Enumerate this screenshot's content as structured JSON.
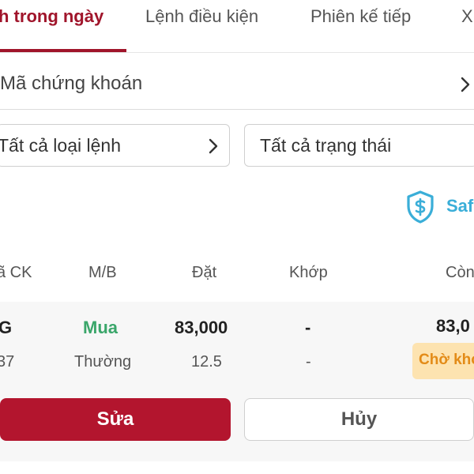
{
  "tabs": {
    "items": [
      {
        "label": "h trong ngày",
        "active": true
      },
      {
        "label": "Lệnh điều kiện",
        "active": false
      },
      {
        "label": "Phiên kế tiếp",
        "active": false
      },
      {
        "label": "X",
        "active": false
      }
    ]
  },
  "symbol_filter": {
    "label": "Mã chứng khoán",
    "icon": "chevron-right-icon"
  },
  "filters": {
    "order_type": {
      "label": "Tất cả loại lệnh",
      "icon": "chevron-right-icon"
    },
    "status": {
      "label": "Tất cả trạng thái"
    }
  },
  "safe_badge": {
    "text": "Saf",
    "icon": "shield-dollar-icon"
  },
  "table": {
    "headers": {
      "symbol": "ã CK",
      "side": "M/B",
      "order": "Đặt",
      "matched": "Khớp",
      "remaining": "Còn"
    }
  },
  "order": {
    "symbol": "G",
    "symbol_sub": "37",
    "side": "Mua",
    "order_type": "Thường",
    "order_price": "83,000",
    "order_qty": "12.5",
    "matched_main": "-",
    "matched_sub": "-",
    "remaining": "83,0",
    "status": "Chờ khớ",
    "edit_label": "Sửa",
    "cancel_label": "Hủy"
  },
  "colors": {
    "brand": "#a0152b",
    "button_primary": "#b3152e",
    "buy": "#3aa66a",
    "safe": "#3aaed8",
    "status_bg": "#fde3b0",
    "status_text": "#e38b17"
  }
}
